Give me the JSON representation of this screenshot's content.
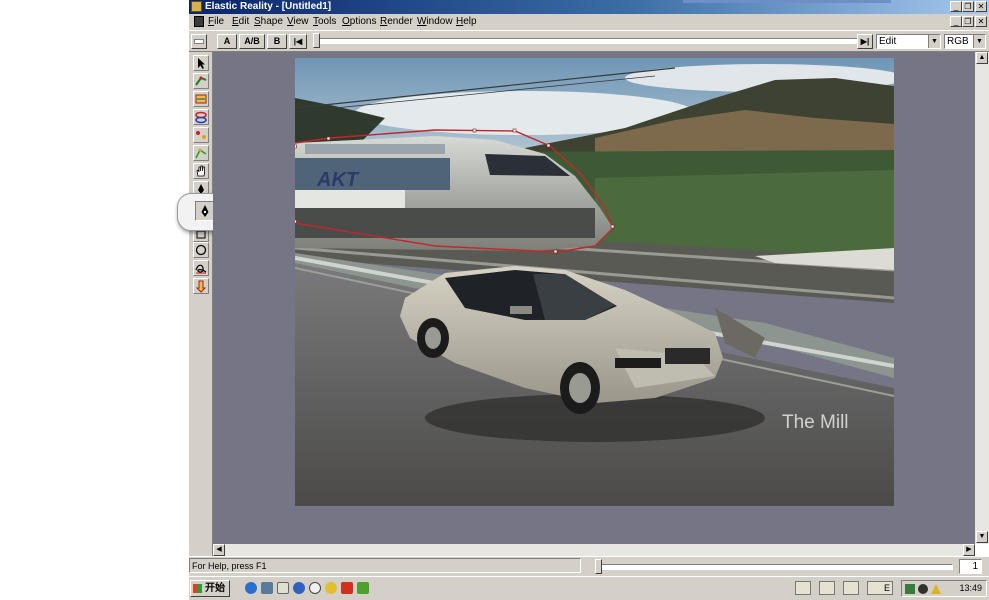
{
  "window": {
    "title": "Elastic Reality - [Untitled1]",
    "controls": [
      "_",
      "❐",
      "✕"
    ]
  },
  "menu": [
    {
      "label": "File",
      "key": "F",
      "rest": "ile"
    },
    {
      "label": "Edit",
      "key": "E",
      "rest": "dit"
    },
    {
      "label": "Shape",
      "key": "S",
      "rest": "hape"
    },
    {
      "label": "View",
      "key": "V",
      "rest": "iew"
    },
    {
      "label": "Tools",
      "key": "T",
      "rest": "ools"
    },
    {
      "label": "Options",
      "key": "O",
      "rest": "ptions"
    },
    {
      "label": "Render",
      "key": "R",
      "rest": "ender"
    },
    {
      "label": "Window",
      "key": "W",
      "rest": "indow"
    },
    {
      "label": "Help",
      "key": "H",
      "rest": "elp"
    }
  ],
  "toolbar": {
    "a_label": "A",
    "ab_label": "A/B",
    "b_label": "B",
    "first_frame": "|◀",
    "last_frame": "▶|",
    "mode_value": "Edit",
    "color_value": "RGB"
  },
  "tools": [
    "arrow-tool-icon",
    "warp-tool-icon",
    "shape-tool-icon",
    "correspondence-tool-icon",
    "point-tool-icon",
    "spline-tool-icon",
    "hand-tool-icon",
    "pen-tool-icon",
    "rectangle-tool-icon",
    "oval-tool-icon",
    "freehand-tool-icon",
    "magnet-tool-icon"
  ],
  "image": {
    "watermark": "The Mill",
    "train_logo": "AKT"
  },
  "status": {
    "help_text": "For Help, press F1",
    "frame_number": "1"
  },
  "taskbar": {
    "start_label": "开始",
    "clock": "13:49",
    "task_label": "E"
  },
  "colors": {
    "title_gradient_start": "#0a246a",
    "title_gradient_end": "#a6caf0",
    "chrome": "#d4d0c8",
    "workspace": "#757585",
    "shape_outline": "#c0282c"
  }
}
